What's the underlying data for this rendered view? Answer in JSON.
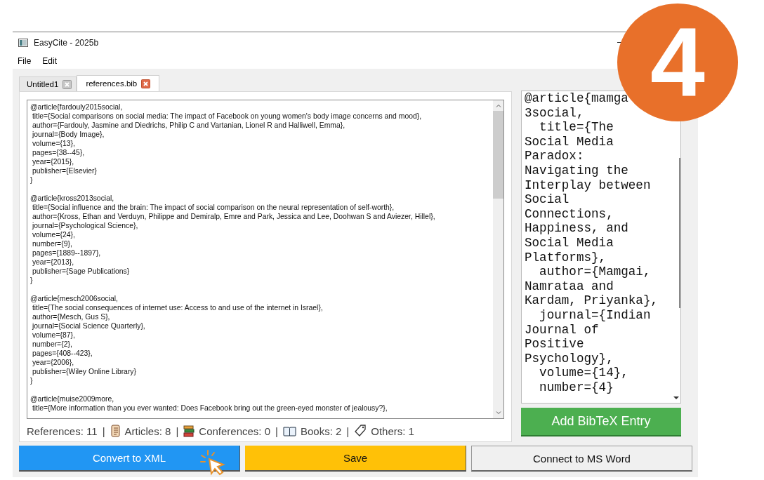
{
  "window": {
    "title": "EasyCite - 2025b"
  },
  "menu": [
    "File",
    "Edit"
  ],
  "tabs": [
    {
      "label": "Untitled1",
      "selected": false
    },
    {
      "label": "references.bib",
      "selected": true
    }
  ],
  "editor": {
    "entries": [
      {
        "lines": [
          "@article{fardouly2015social,",
          " title={Social comparisons on social media: The impact of Facebook on young women's body image concerns and mood},",
          " author={Fardouly, Jasmine and Diedrichs, Philip C and Vartanian, Lionel R and Halliwell, Emma},",
          " journal={Body Image},",
          " volume={13},",
          " pages={38--45},",
          " year={2015},",
          " publisher={Elsevier}",
          "}"
        ]
      },
      {
        "lines": [
          "@article{kross2013social,",
          " title={Social influence and the brain: The impact of social comparison on the neural representation of self-worth},",
          " author={Kross, Ethan and Verduyn, Philippe and Demiralp, Emre and Park, Jessica and Lee, Doohwan S and Aviezer, Hillel},",
          " journal={Psychological Science},",
          " volume={24},",
          " number={9},",
          " pages={1889--1897},",
          " year={2013},",
          " publisher={Sage Publications}",
          "}"
        ]
      },
      {
        "lines": [
          "@article{mesch2006social,",
          " title={The social consequences of internet use: Access to and use of the internet in Israel},",
          " author={Mesch, Gus S},",
          " journal={Social Science Quarterly},",
          " volume={87},",
          " number={2},",
          " pages={408--423},",
          " year={2006},",
          " publisher={Wiley Online Library}",
          "}"
        ]
      },
      {
        "lines": [
          "@article{muise2009more,",
          " title={More information than you ever wanted: Does Facebook bring out the green-eyed monster of jealousy?},"
        ]
      }
    ]
  },
  "stats": {
    "separator": "|",
    "items": [
      {
        "kind": "total",
        "text": "References: 11"
      },
      {
        "kind": "articles",
        "text": "Articles: 8"
      },
      {
        "kind": "conferences",
        "text": "Conferences: 0"
      },
      {
        "kind": "books",
        "text": "Books: 2"
      },
      {
        "kind": "others",
        "text": "Others: 1"
      }
    ]
  },
  "entry_editor": {
    "lines": [
      "@article{mamga",
      "3social,",
      "  title={The",
      "Social Media",
      "Paradox:",
      "Navigating the",
      "Interplay between",
      "Social",
      "Connections,",
      "Happiness, and",
      "Social Media",
      "Platforms},",
      "  author={Mamgai,",
      "Namrataa and",
      "Kardam, Priyanka},",
      "  journal={Indian",
      "Journal of",
      "Positive",
      "Psychology},",
      "  volume={14},",
      "  number={4}"
    ]
  },
  "add_button": "Add BibTeX Entry",
  "buttons": [
    {
      "kind": "convert",
      "label": "Convert to XML"
    },
    {
      "kind": "save",
      "label": "Save"
    },
    {
      "kind": "word",
      "label": "Connect to MS Word"
    }
  ],
  "step_badge": "4"
}
